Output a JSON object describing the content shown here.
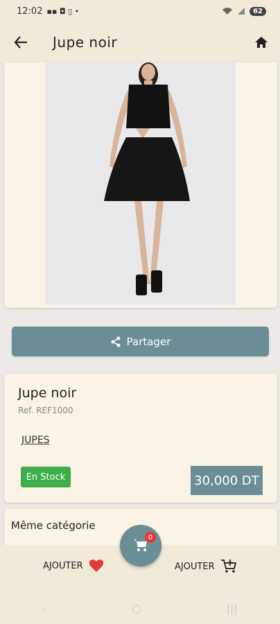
{
  "status": {
    "time": "12:02",
    "battery": "62"
  },
  "app_bar": {
    "title": "Jupe  noir"
  },
  "share": {
    "label": "Partager"
  },
  "product": {
    "name": "Jupe  noir",
    "ref": "Ref.  REF1000",
    "category": "JUPES",
    "stock": "En  Stock",
    "price": "30,000  DT"
  },
  "same_category": {
    "title": "Même  catégorie"
  },
  "bottom": {
    "fav_label": "AJOUTER",
    "cart_label": "AJOUTER",
    "cart_count": "0"
  },
  "colors": {
    "accent": "#6B8E96",
    "stock_green": "#3DAE49",
    "heart_red": "#E53935",
    "card_bg": "#FBF3E5"
  }
}
